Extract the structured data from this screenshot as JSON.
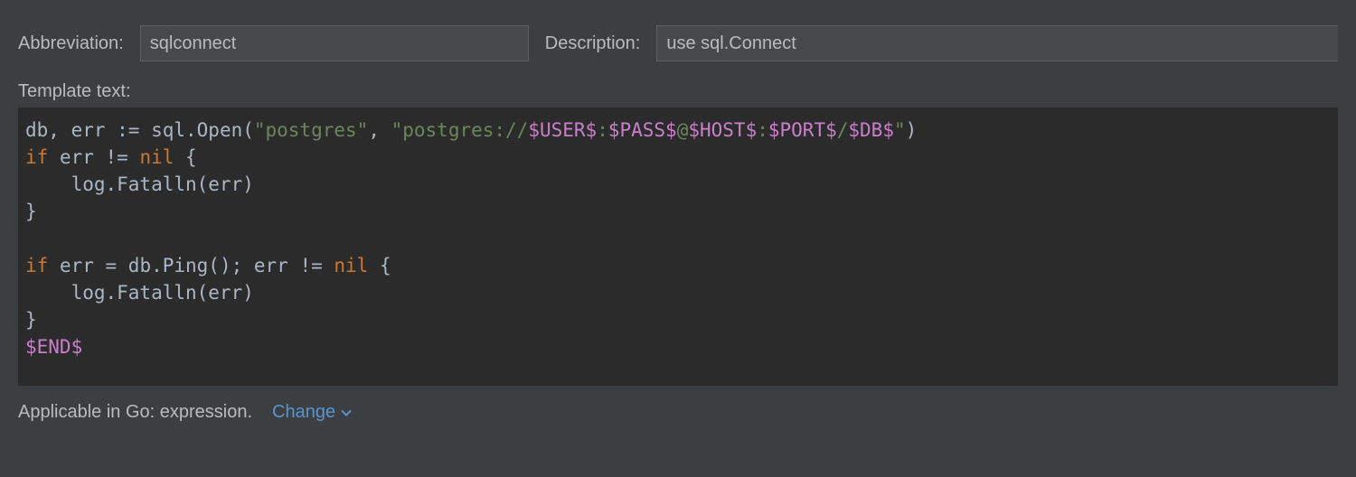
{
  "header": {
    "abbreviation_label": "Abbreviation:",
    "abbreviation_value": "sqlconnect",
    "description_label": "Description:",
    "description_value": "use sql.Connect"
  },
  "template": {
    "label": "Template text:",
    "tokens": [
      [
        {
          "t": "db",
          "c": ""
        },
        {
          "t": ", err := sql.Open(",
          "c": ""
        },
        {
          "t": "\"postgres\"",
          "c": "str"
        },
        {
          "t": ", ",
          "c": ""
        },
        {
          "t": "\"postgres://",
          "c": "str"
        },
        {
          "t": "$USER$",
          "c": "var"
        },
        {
          "t": ":",
          "c": "str"
        },
        {
          "t": "$PASS$",
          "c": "var"
        },
        {
          "t": "@",
          "c": "str"
        },
        {
          "t": "$HOST$",
          "c": "var"
        },
        {
          "t": ":",
          "c": "str"
        },
        {
          "t": "$PORT$",
          "c": "var"
        },
        {
          "t": "/",
          "c": "str"
        },
        {
          "t": "$DB$",
          "c": "var"
        },
        {
          "t": "\"",
          "c": "str"
        },
        {
          "t": ")",
          "c": ""
        }
      ],
      [
        {
          "t": "if",
          "c": "kw"
        },
        {
          "t": " err != ",
          "c": ""
        },
        {
          "t": "nil",
          "c": "kw"
        },
        {
          "t": " {",
          "c": ""
        }
      ],
      [
        {
          "t": "    log.Fatalln(err)",
          "c": ""
        }
      ],
      [
        {
          "t": "}",
          "c": ""
        }
      ],
      [],
      [
        {
          "t": "if",
          "c": "kw"
        },
        {
          "t": " err = db.Ping(); err != ",
          "c": ""
        },
        {
          "t": "nil",
          "c": "kw"
        },
        {
          "t": " {",
          "c": ""
        }
      ],
      [
        {
          "t": "    log.Fatalln(err)",
          "c": ""
        }
      ],
      [
        {
          "t": "}",
          "c": ""
        }
      ],
      [
        {
          "t": "$END$",
          "c": "var"
        }
      ]
    ]
  },
  "footer": {
    "applicable_text": "Applicable in Go: expression.",
    "change_label": "Change"
  }
}
